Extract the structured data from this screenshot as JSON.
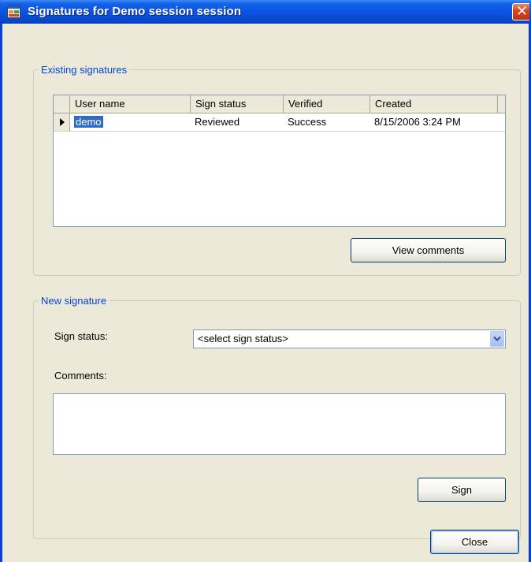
{
  "window": {
    "title": "Signatures for Demo session session",
    "close_glyph": "✕",
    "icon": "app-window-icon",
    "accent": "#0a55e2"
  },
  "existing": {
    "legend": "Existing signatures",
    "columns": [
      "User name",
      "Sign status",
      "Verified",
      "Created"
    ],
    "rows": [
      {
        "user": "demo",
        "status": "Reviewed",
        "verified": "Success",
        "created": "8/15/2006 3:24 PM"
      }
    ],
    "view_comments_label": "View comments"
  },
  "new_signature": {
    "legend": "New signature",
    "sign_status_label": "Sign status:",
    "sign_status_value": "<select sign status>",
    "comments_label": "Comments:",
    "comments_value": "",
    "sign_label": "Sign"
  },
  "close_label": "Close"
}
